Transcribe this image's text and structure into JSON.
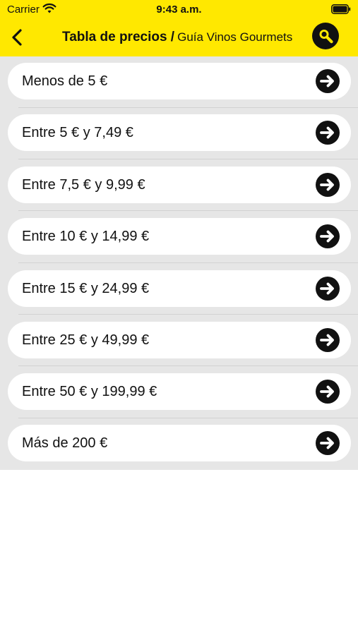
{
  "status_bar": {
    "carrier": "Carrier",
    "time": "9:43 a.m."
  },
  "nav": {
    "title": "Tabla de precios /",
    "subtitle": "Guía Vinos Gourmets",
    "back_icon": "chevron-left-icon",
    "search_icon": "search-icon"
  },
  "colors": {
    "accent": "#ffe800",
    "list_background": "#e6e6e6",
    "row_background": "#ffffff",
    "icon": "#111111"
  },
  "price_ranges": [
    {
      "label": "Menos de 5 €",
      "icon": "arrow-right-circle-icon"
    },
    {
      "label": "Entre 5 € y 7,49 €",
      "icon": "arrow-right-circle-icon"
    },
    {
      "label": "Entre 7,5 € y 9,99 €",
      "icon": "arrow-right-circle-icon"
    },
    {
      "label": "Entre 10 € y 14,99 €",
      "icon": "arrow-right-circle-icon"
    },
    {
      "label": "Entre 15 € y 24,99 €",
      "icon": "arrow-right-circle-icon"
    },
    {
      "label": "Entre 25 € y 49,99 €",
      "icon": "arrow-right-circle-icon"
    },
    {
      "label": "Entre 50 € y 199,99 €",
      "icon": "arrow-right-circle-icon"
    },
    {
      "label": "Más de 200 €",
      "icon": "arrow-right-circle-icon"
    }
  ]
}
